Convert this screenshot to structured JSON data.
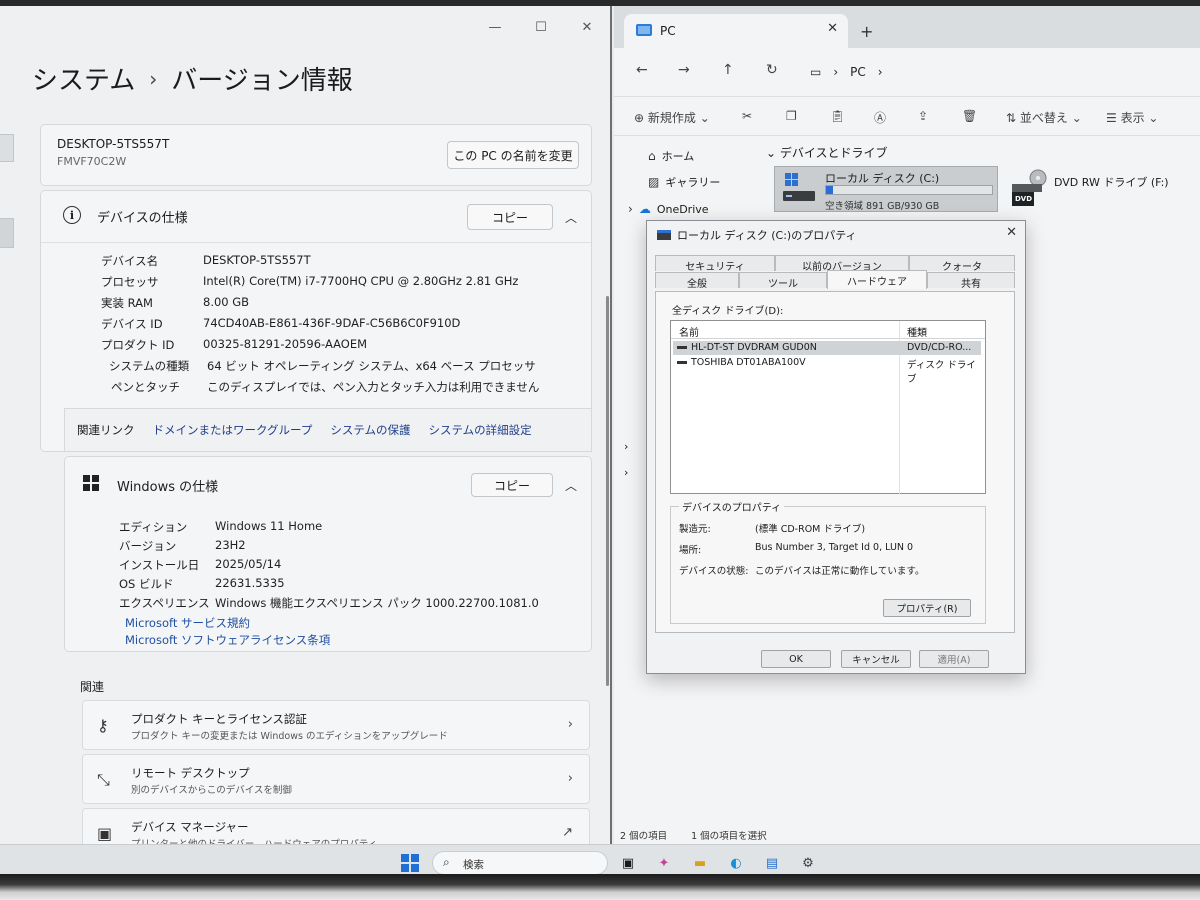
{
  "settings": {
    "breadcrumb_parent": "システム",
    "breadcrumb_sep": "›",
    "breadcrumb_current": "バージョン情報",
    "device_name_title": "DESKTOP-5TS557T",
    "device_model": "FMVF70C2W",
    "rename_button": "この PC の名前を変更",
    "device_spec": {
      "heading": "デバイスの仕様",
      "copy_label": "コピー",
      "rows": [
        {
          "key": "デバイス名",
          "value": "DESKTOP-5TS557T"
        },
        {
          "key": "プロセッサ",
          "value": "Intel(R) Core(TM) i7-7700HQ CPU @ 2.80GHz   2.81 GHz"
        },
        {
          "key": "実装 RAM",
          "value": "8.00 GB"
        },
        {
          "key": "デバイス ID",
          "value": "74CD40AB-E861-436F-9DAF-C56B6C0F910D"
        },
        {
          "key": "プロダクト ID",
          "value": "00325-81291-20596-AAOEM"
        },
        {
          "key": "システムの種類",
          "value": "64 ビット オペレーティング システム、x64 ベース プロセッサ"
        },
        {
          "key": "ペンとタッチ",
          "value": "このディスプレイでは、ペン入力とタッチ入力は利用できません"
        }
      ]
    },
    "related_links": {
      "label": "関連リンク",
      "items": [
        "ドメインまたはワークグループ",
        "システムの保護",
        "システムの詳細設定"
      ]
    },
    "windows_spec": {
      "heading": "Windows の仕様",
      "copy_label": "コピー",
      "rows": [
        {
          "key": "エディション",
          "value": "Windows 11 Home"
        },
        {
          "key": "バージョン",
          "value": "23H2"
        },
        {
          "key": "インストール日",
          "value": "2025/05/14"
        },
        {
          "key": "OS ビルド",
          "value": "22631.5335"
        },
        {
          "key": "エクスペリエンス",
          "value": "Windows 機能エクスペリエンス パック 1000.22700.1081.0"
        }
      ],
      "links": [
        "Microsoft サービス規約",
        "Microsoft ソフトウェアライセンス条項"
      ]
    },
    "related_section": "関連",
    "related_items": [
      {
        "title": "プロダクト キーとライセンス認証",
        "desc": "プロダクト キーの変更または Windows のエディションをアップグレード"
      },
      {
        "title": "リモート デスクトップ",
        "desc": "別のデバイスからこのデバイスを制御"
      },
      {
        "title": "デバイス マネージャー",
        "desc": "プリンターと他のドライバー、ハードウェアのプロパティ"
      }
    ]
  },
  "explorer": {
    "tab_title": "PC",
    "path_segment": "PC",
    "toolbar": {
      "new": "新規作成",
      "sort": "並べ替え",
      "view": "表示"
    },
    "nav": {
      "home": "ホーム",
      "gallery": "ギャラリー",
      "onedrive": "OneDrive"
    },
    "group_heading": "デバイスとドライブ",
    "drive_c": {
      "name": "ローカル ディスク (C:)",
      "free": "空き領域 891 GB/930 GB",
      "used_fraction": 0.04
    },
    "drive_d": {
      "name": "DVD RW ドライブ (F:)",
      "badge": "DVD"
    },
    "status": {
      "items": "2 個の項目",
      "selected": "1 個の項目を選択"
    }
  },
  "dialog": {
    "title": "ローカル ディスク (C:)のプロパティ",
    "tabs_row1": [
      "セキュリティ",
      "以前のバージョン",
      "クォータ"
    ],
    "tabs_row2": [
      "全般",
      "ツール",
      "ハードウェア",
      "共有"
    ],
    "all_drives_label": "全ディスク ドライブ(D):",
    "col_name": "名前",
    "col_type": "種類",
    "drives": [
      {
        "name": "HL-DT-ST DVDRAM GUD0N",
        "type": "DVD/CD-RO..."
      },
      {
        "name": "TOSHIBA DT01ABA100V",
        "type": "ディスク ドライブ"
      }
    ],
    "props_legend": "デバイスのプロパティ",
    "props": [
      {
        "key": "製造元:",
        "value": "(標準 CD-ROM ドライブ)"
      },
      {
        "key": "場所:",
        "value": "Bus Number 3, Target Id 0, LUN 0"
      },
      {
        "key": "デバイスの状態:",
        "value": "このデバイスは正常に動作しています。"
      }
    ],
    "properties_button": "プロパティ(R)",
    "ok": "OK",
    "cancel": "キャンセル",
    "apply": "適用(A)"
  },
  "taskbar": {
    "search_placeholder": "検索"
  }
}
